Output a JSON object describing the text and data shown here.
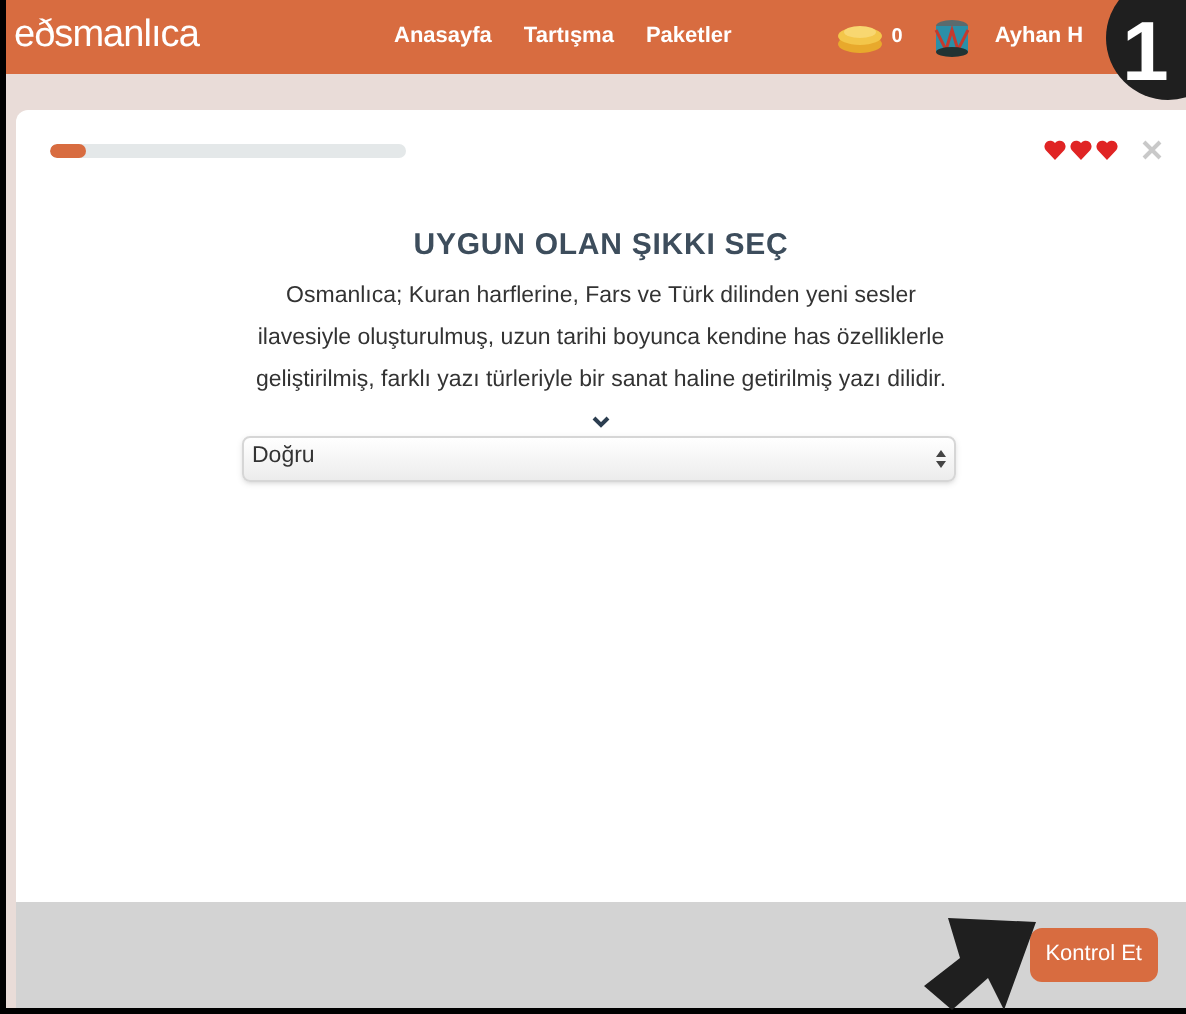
{
  "header": {
    "logo": "eðsmanlıca",
    "nav": [
      {
        "label": "Anasayfa"
      },
      {
        "label": "Tartışma"
      },
      {
        "label": "Paketler"
      }
    ],
    "coins": "0",
    "user": "Ayhan H"
  },
  "quiz": {
    "progress": {
      "level": 0.1
    },
    "lives": [
      {
        "filled": true
      },
      {
        "filled": true
      },
      {
        "filled": true
      }
    ],
    "title": "UYGUN OLAN ŞIKKI SEÇ",
    "question": "Osmanlıca; Kuran harflerine, Fars ve Türk dilinden yeni sesler ilavesiyle oluşturulmuş, uzun tarihi boyunca kendine has özelliklerle geliştirilmiş, farklı yazı türleriyle bir sanat haline getirilmiş yazı dilidir.",
    "answer": {
      "value": "Doğru"
    },
    "check_button": "Kontrol Et"
  },
  "annotation": {
    "step": "1"
  }
}
